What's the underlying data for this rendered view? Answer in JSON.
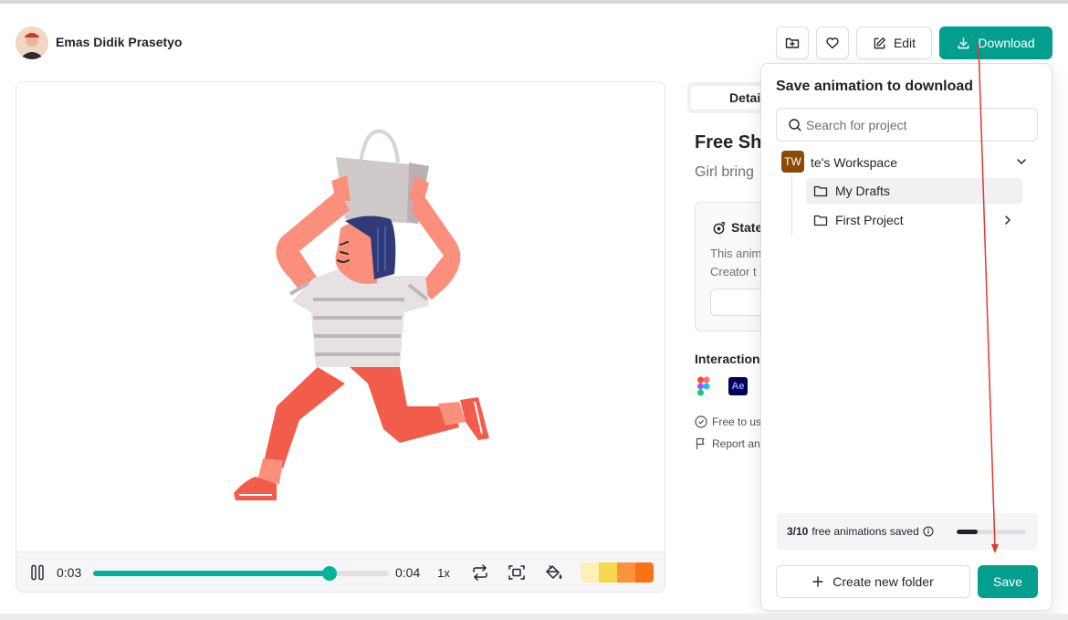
{
  "header": {
    "author_name": "Emas Didik Prasetyo",
    "edit_label": "Edit",
    "download_label": "Download"
  },
  "player": {
    "current_time": "0:03",
    "total_time": "0:04",
    "speed": "1x",
    "progress": 0.8,
    "palette": [
      "#fdf0b8",
      "#f5d84b",
      "#fb923c",
      "#f97316"
    ]
  },
  "details": {
    "tab_active": "Detai",
    "title": "Free Sho",
    "subtitle": "Girl bring",
    "state_title": "State",
    "state_text_line1": "This anim",
    "state_text_line2": "Creator t",
    "interaction_label": "Interaction",
    "free_to_use": "Free to us",
    "report": "Report an"
  },
  "popover": {
    "title": "Save animation to download",
    "search_placeholder": "Search for project",
    "workspace": {
      "initials": "TW",
      "name": "te's Workspace"
    },
    "folders": [
      {
        "label": "My Drafts"
      },
      {
        "label": "First Project"
      }
    ],
    "quota": {
      "used": "3/10",
      "suffix": "free animations saved",
      "fraction": 0.3
    },
    "create_folder_label": "Create new folder",
    "save_label": "Save"
  },
  "annotation": {
    "arrow_color": "#e5372f"
  }
}
